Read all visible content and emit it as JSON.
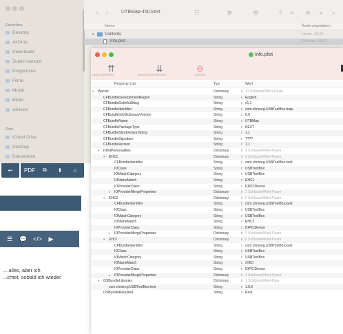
{
  "finder": {
    "title": "UTBMap-450.kext",
    "sidebar": {
      "section_favorites": "Favoriten",
      "favorites": [
        "Desktop",
        "AirDrop",
        "Downloads",
        "Zuletzt benutzt",
        "Programme",
        "Filme",
        "Musik",
        "Bilder",
        "vitvision"
      ],
      "section_places": "Orte",
      "places": [
        "iCloud Drive",
        "Desktop",
        "Dokumente"
      ]
    },
    "columns": {
      "name": "Name",
      "date": "Änderungsdatum"
    },
    "rows": [
      {
        "name": "Contents",
        "date": "Heute, 10:22"
      },
      {
        "name": "Info.plist",
        "date": "Gestern, 18:37"
      }
    ]
  },
  "plist": {
    "title": "Info.plist",
    "toolbar": [
      {
        "icon": "add-item-icon",
        "label": "Neues Element"
      },
      {
        "icon": "add-child-icon",
        "label": "Neues Kind-Element"
      },
      {
        "icon": "delete-icon",
        "label": "Löschen"
      }
    ],
    "columns": {
      "key": "Property List",
      "type": "Typ",
      "value": "Wert"
    },
    "rows": [
      {
        "indent": 0,
        "tri": "▾",
        "key": "Wurzel",
        "type": "Dictionary",
        "value": "13 Schlüssel/Wert-Paare",
        "muted": true
      },
      {
        "indent": 1,
        "key": "CFBundleDevelopmentRegion",
        "type": "String",
        "value": "English"
      },
      {
        "indent": 1,
        "key": "CFBundleGetInfoString",
        "type": "String",
        "value": "v1.1"
      },
      {
        "indent": 1,
        "key": "CFBundleIdentifier",
        "type": "String",
        "value": "com.chrisreg.USBToolBox.map"
      },
      {
        "indent": 1,
        "key": "CFBundleInfoDictionaryVersion",
        "type": "String",
        "value": "6.0"
      },
      {
        "indent": 1,
        "key": "CFBundleName",
        "type": "String",
        "value": "UTBMap"
      },
      {
        "indent": 1,
        "key": "CFBundlePackageType",
        "type": "String",
        "value": "KEXT"
      },
      {
        "indent": 1,
        "key": "CFBundleShortVersionString",
        "type": "String",
        "value": "1.1"
      },
      {
        "indent": 1,
        "key": "CFBundleSignature",
        "type": "String",
        "value": "????"
      },
      {
        "indent": 1,
        "key": "CFBundleVersion",
        "type": "String",
        "value": "1.1"
      },
      {
        "indent": 1,
        "tri": "▾",
        "key": "IOKitPersonalities",
        "type": "Dictionary",
        "value": "3 Schlüssel/Wert-Paare",
        "muted": true
      },
      {
        "indent": 2,
        "tri": "▾",
        "key": "EHC1",
        "type": "Dictionary",
        "value": "6 Schlüssel/Wert-Paare",
        "muted": true
      },
      {
        "indent": 3,
        "key": "CFBundleIdentifier",
        "type": "String",
        "value": "com.chrisreg.USBToolBox.kext"
      },
      {
        "indent": 3,
        "key": "IOClass",
        "type": "String",
        "value": "USBToolBox"
      },
      {
        "indent": 3,
        "key": "IOMatchCategory",
        "type": "String",
        "value": "USBToolBox"
      },
      {
        "indent": 3,
        "key": "IONameMatch",
        "type": "String",
        "value": "EHC1"
      },
      {
        "indent": 3,
        "key": "IOProviderClass",
        "type": "String",
        "value": "IOPCIDevice"
      },
      {
        "indent": 3,
        "tri": "▸",
        "key": "IOProviderMergeProperties",
        "type": "Dictionary",
        "value": "2 Schlüssel/Wert-Paare",
        "muted": true
      },
      {
        "indent": 2,
        "tri": "▾",
        "key": "EHC2",
        "type": "Dictionary",
        "value": "6 Schlüssel/Wert-Paare",
        "muted": true
      },
      {
        "indent": 3,
        "key": "CFBundleIdentifier",
        "type": "String",
        "value": "com.chrisreg.USBToolBox.kext"
      },
      {
        "indent": 3,
        "key": "IOClass",
        "type": "String",
        "value": "USBToolBox"
      },
      {
        "indent": 3,
        "key": "IOMatchCategory",
        "type": "String",
        "value": "USBToolBox"
      },
      {
        "indent": 3,
        "key": "IONameMatch",
        "type": "String",
        "value": "EHC2"
      },
      {
        "indent": 3,
        "key": "IOProviderClass",
        "type": "String",
        "value": "IOPCIDevice"
      },
      {
        "indent": 3,
        "tri": "▸",
        "key": "IOProviderMergeProperties",
        "type": "Dictionary",
        "value": "2 Schlüssel/Wert-Paare",
        "muted": true
      },
      {
        "indent": 2,
        "tri": "▾",
        "key": "XHCI",
        "type": "Dictionary",
        "value": "6 Schlüssel/Wert-Paare",
        "muted": true
      },
      {
        "indent": 3,
        "key": "CFBundleIdentifier",
        "type": "String",
        "value": "com.chrisreg.USBToolBox.kext"
      },
      {
        "indent": 3,
        "key": "IOClass",
        "type": "String",
        "value": "USBToolBox"
      },
      {
        "indent": 3,
        "key": "IOMatchCategory",
        "type": "String",
        "value": "USBToolBox"
      },
      {
        "indent": 3,
        "key": "IONameMatch",
        "type": "String",
        "value": "XHCI"
      },
      {
        "indent": 3,
        "key": "IOProviderClass",
        "type": "String",
        "value": "IOPCIDevice"
      },
      {
        "indent": 3,
        "tri": "▸",
        "key": "IOProviderMergeProperties",
        "type": "Dictionary",
        "value": "2 Schlüssel/Wert-Paare",
        "muted": true
      },
      {
        "indent": 1,
        "tri": "▾",
        "key": "OSBundleLibraries",
        "type": "Dictionary",
        "value": "1 Schlüssel/Wert-Paar",
        "muted": true
      },
      {
        "indent": 2,
        "key": "com.chrisreg.USBToolBox.kext",
        "type": "String",
        "value": "1.0.0"
      },
      {
        "indent": 1,
        "key": "OSBundleRequired",
        "type": "String",
        "value": "Root"
      }
    ]
  },
  "browser": {
    "toolbar_buttons": [
      "↩",
      "PDF",
      "⧉",
      "⬆",
      "⌂"
    ],
    "editor_icons": [
      "☰",
      "💬",
      "</>",
      "▶"
    ],
    "text_lines": [
      "... alles, aber ich",
      "...chtet, sobald ich wieder"
    ]
  }
}
